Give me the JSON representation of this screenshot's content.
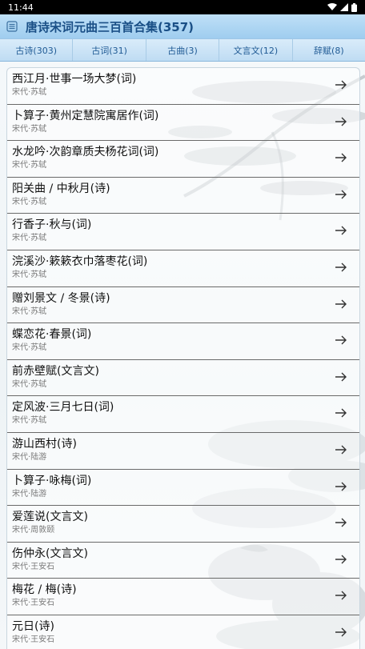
{
  "status_bar": {
    "time": "11:44",
    "icons": [
      "wifi-icon",
      "signal-icon",
      "battery-icon"
    ]
  },
  "header": {
    "title": "唐诗宋词元曲三百首合集(357)",
    "menu_icon": "list-icon"
  },
  "tabs": [
    {
      "label": "古诗(303)"
    },
    {
      "label": "古词(31)"
    },
    {
      "label": "古曲(3)"
    },
    {
      "label": "文言文(12)"
    },
    {
      "label": "辞赋(8)"
    }
  ],
  "items": [
    {
      "title": "西江月·世事一场大梦(词)",
      "subtitle": "宋代·苏轼"
    },
    {
      "title": "卜算子·黄州定慧院寓居作(词)",
      "subtitle": "宋代·苏轼"
    },
    {
      "title": "水龙吟·次韵章质夫杨花词(词)",
      "subtitle": "宋代·苏轼"
    },
    {
      "title": "阳关曲 / 中秋月(诗)",
      "subtitle": "宋代·苏轼"
    },
    {
      "title": "行香子·秋与(词)",
      "subtitle": "宋代·苏轼"
    },
    {
      "title": "浣溪沙·簌簌衣巾落枣花(词)",
      "subtitle": "宋代·苏轼"
    },
    {
      "title": "赠刘景文 / 冬景(诗)",
      "subtitle": "宋代·苏轼"
    },
    {
      "title": "蝶恋花·春景(词)",
      "subtitle": "宋代·苏轼"
    },
    {
      "title": "前赤壁赋(文言文)",
      "subtitle": "宋代·苏轼"
    },
    {
      "title": "定风波·三月七日(词)",
      "subtitle": "宋代·苏轼"
    },
    {
      "title": "游山西村(诗)",
      "subtitle": "宋代·陆游"
    },
    {
      "title": "卜算子·咏梅(词)",
      "subtitle": "宋代·陆游"
    },
    {
      "title": "爱莲说(文言文)",
      "subtitle": "宋代·周敦颐"
    },
    {
      "title": "伤仲永(文言文)",
      "subtitle": "宋代·王安石"
    },
    {
      "title": "梅花 / 梅(诗)",
      "subtitle": "宋代·王安石"
    },
    {
      "title": "元日(诗)",
      "subtitle": "宋代·王安石"
    }
  ],
  "colors": {
    "title_bar": "#a9d4f2",
    "title_text": "#1a4f86",
    "tab_text": "#1f5a94"
  }
}
